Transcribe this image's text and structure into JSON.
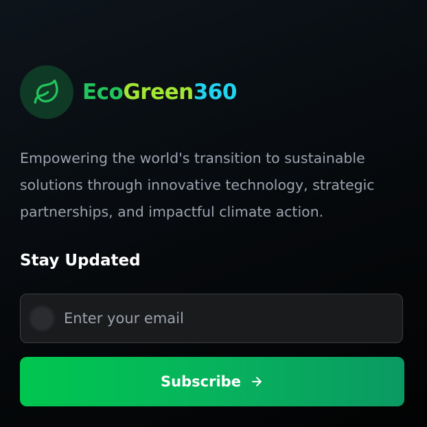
{
  "brand": {
    "name_part1": "Eco",
    "name_part2": "Green",
    "name_part3": "360",
    "icon": "leaf-icon",
    "colors": {
      "eco": "#22c55e",
      "green": "#a3e635",
      "number": "#22d3ee",
      "icon_bg": "#0f3a26"
    }
  },
  "tagline": "Empowering the world's transition to sustainable solutions through innovative technology, strategic partnerships, and impactful climate action.",
  "newsletter": {
    "heading": "Stay Updated",
    "email_placeholder": "Enter your email",
    "email_value": "",
    "mail_icon": "mail-icon",
    "subscribe_label": "Subscribe",
    "subscribe_icon": "arrow-right-icon",
    "button_colors": [
      "#00c64f",
      "#0a9a63"
    ]
  }
}
